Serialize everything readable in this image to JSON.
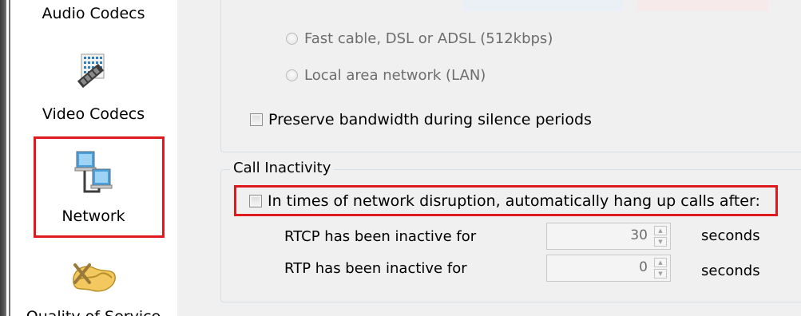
{
  "sidebar": {
    "items": [
      {
        "label": "Audio Codecs",
        "icon": "audio-codecs-icon"
      },
      {
        "label": "Video Codecs",
        "icon": "video-codecs-icon"
      },
      {
        "label": "Network",
        "icon": "network-icon",
        "selected": true
      },
      {
        "label": "Quality of Service",
        "icon": "quality-of-service-icon"
      }
    ]
  },
  "bandwidth": {
    "options": [
      {
        "label": "Fast cable, DSL or ADSL (512kbps)",
        "enabled": false
      },
      {
        "label": "Local area network (LAN)",
        "enabled": false
      }
    ],
    "preserve_checkbox_label": "Preserve bandwidth during silence periods"
  },
  "call_inactivity": {
    "title": "Call Inactivity",
    "hangup_checkbox_label": "In times of network disruption, automatically hang up calls after:",
    "rtcp_label": "RTCP has been inactive for",
    "rtcp_value": "30",
    "rtp_label": "RTP has been inactive for",
    "rtp_value": "0",
    "unit_label": "seconds"
  },
  "colors": {
    "highlight": "#e0191f",
    "panel_background": "#f0f0f0",
    "disabled_text": "#6d6d6d"
  }
}
